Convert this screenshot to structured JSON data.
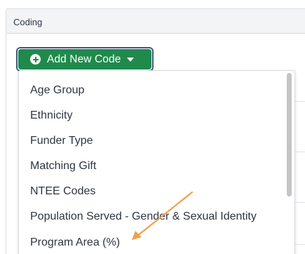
{
  "panel": {
    "title": "Coding"
  },
  "button": {
    "label": "Add New Code"
  },
  "menu": {
    "items": [
      "Age Group",
      "Ethnicity",
      "Funder Type",
      "Matching Gift",
      "NTEE Codes",
      "Population Served - Gender & Sexual Identity",
      "Program Area (%)"
    ]
  },
  "colors": {
    "button_green": "#1f8a4c",
    "annotation_arrow": "#f0a04b"
  }
}
